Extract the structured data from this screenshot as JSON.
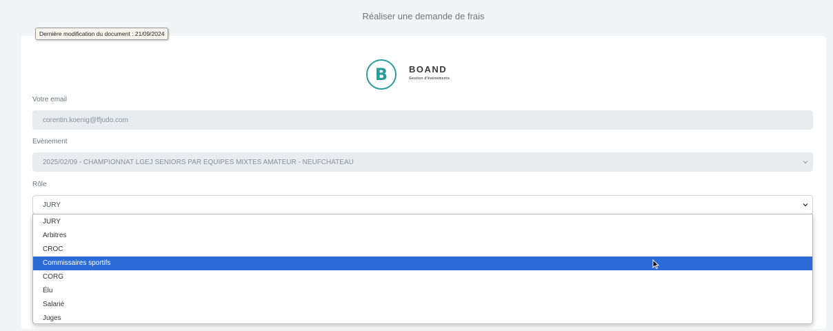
{
  "header": {
    "title": "Réaliser une demande de frais"
  },
  "tooltip": {
    "text": "Dernière modification du document : 21/09/2024"
  },
  "logo": {
    "letter": "B",
    "name": "BOAND",
    "tagline": "Gestion d'événements",
    "color": "#2a9d9a"
  },
  "form": {
    "email": {
      "label": "Votre email",
      "value": "corentin.koenig@ffjudo.com"
    },
    "event": {
      "label": "Evènement",
      "value": "2025/02/09 - CHAMPIONNAT LGEJ SENIORS PAR EQUIPES MIXTES AMATEUR - NEUFCHATEAU"
    },
    "role": {
      "label": "Rôle",
      "value": "JURY",
      "options": [
        "JURY",
        "Arbitres",
        "CROC",
        "Commissaires sportifs",
        "CORG",
        "Élu",
        "Salarié",
        "Juges"
      ],
      "highlighted": "Commissaires sportifs"
    }
  },
  "colors": {
    "highlight": "#2c6bd6",
    "disabled_bg": "#e9ecef",
    "page_bg": "#f3f4f6"
  }
}
